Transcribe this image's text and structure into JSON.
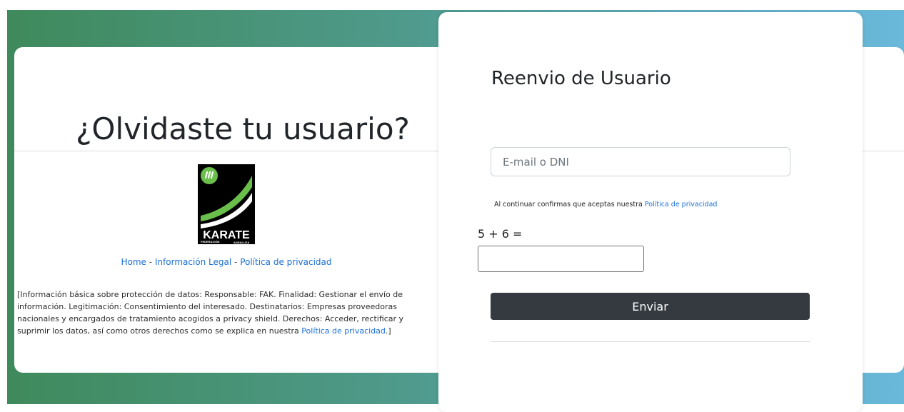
{
  "left": {
    "title": "¿Olvidaste tu usuario?",
    "logo": {
      "icon": "karate-federation-logo",
      "word": "KARATE",
      "line1": "FEDERACIÓN",
      "line2": "ANDALUZA"
    },
    "links": {
      "home": "Home",
      "sep1": " - ",
      "legal": "Información Legal",
      "sep2": " - ",
      "privacy": "Política de privacidad"
    },
    "legal_text": "[Información básica sobre protección de datos: Responsable: FAK. Finalidad: Gestionar el envío de información. Legitimación: Consentimiento del interesado. Destinatarios: Empresas proveedoras nacionales y encargados de tratamiento acogidos a privacy shield. Derechos: Acceder, rectificar y suprimir los datos, así como otros derechos como se explica en nuestra ",
    "legal_link": "Política de privacidad",
    "legal_end": ".]"
  },
  "form": {
    "title": "Reenvio de Usuario",
    "email_placeholder": "E-mail o DNI",
    "email_value": "",
    "consent_text": "Al continuar confirmas que aceptas nuestra",
    "consent_link": "Política de privacidad",
    "captcha_question": "5 + 6 =",
    "captcha_value": "",
    "submit_label": "Enviar"
  },
  "colors": {
    "link": "#1a6fd6",
    "button": "#343a40",
    "gradient_start": "#3f8a5c",
    "gradient_end": "#6ab8da"
  }
}
